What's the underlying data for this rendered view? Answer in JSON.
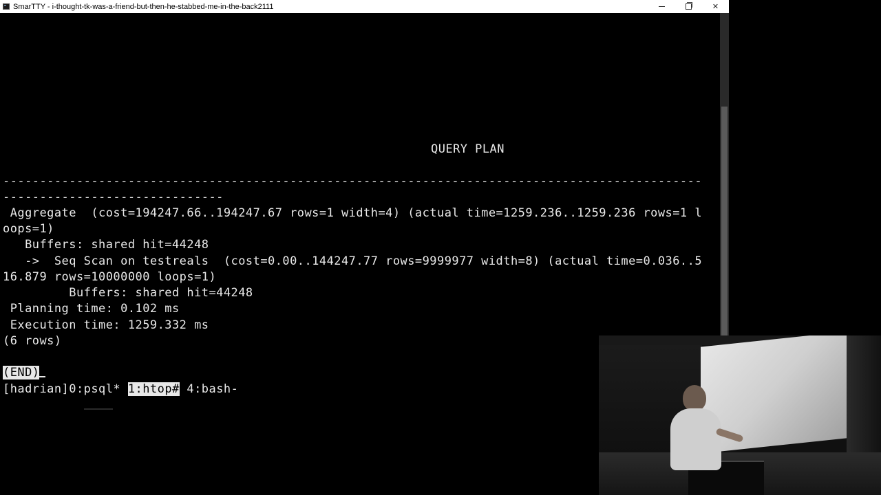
{
  "window": {
    "title": "SmarTTY - i-thought-tk-was-a-friend-but-then-he-stabbed-me-in-the-back2111",
    "controls": {
      "minimize": "minimize",
      "maximize": "restore",
      "close": "✕"
    }
  },
  "terminal": {
    "query_plan_header": "QUERY PLAN",
    "separator_1": "-----------------------------------------------------------------------------------------------",
    "separator_2": "------------------------------",
    "lines": [
      " Aggregate  (cost=194247.66..194247.67 rows=1 width=4) (actual time=1259.236..1259.236 rows=1 l",
      "oops=1)",
      "   Buffers: shared hit=44248",
      "   ->  Seq Scan on testreals  (cost=0.00..144247.77 rows=9999977 width=8) (actual time=0.036..5",
      "16.879 rows=10000000 loops=1)",
      "         Buffers: shared hit=44248",
      " Planning time: 0.102 ms",
      " Execution time: 1259.332 ms",
      "(6 rows)"
    ],
    "pager_prompt": "(END)",
    "status_bar": {
      "session": "[hadrian]",
      "win0": "0:psql*",
      "win1": "1:htop#",
      "win4": "4:bash-"
    }
  },
  "colors": {
    "terminal_bg": "#000000",
    "terminal_fg": "#e8e8e8",
    "titlebar_bg": "#ffffff"
  },
  "icons": [
    "app-icon",
    "minimize-icon",
    "maximize-icon",
    "close-icon"
  ]
}
